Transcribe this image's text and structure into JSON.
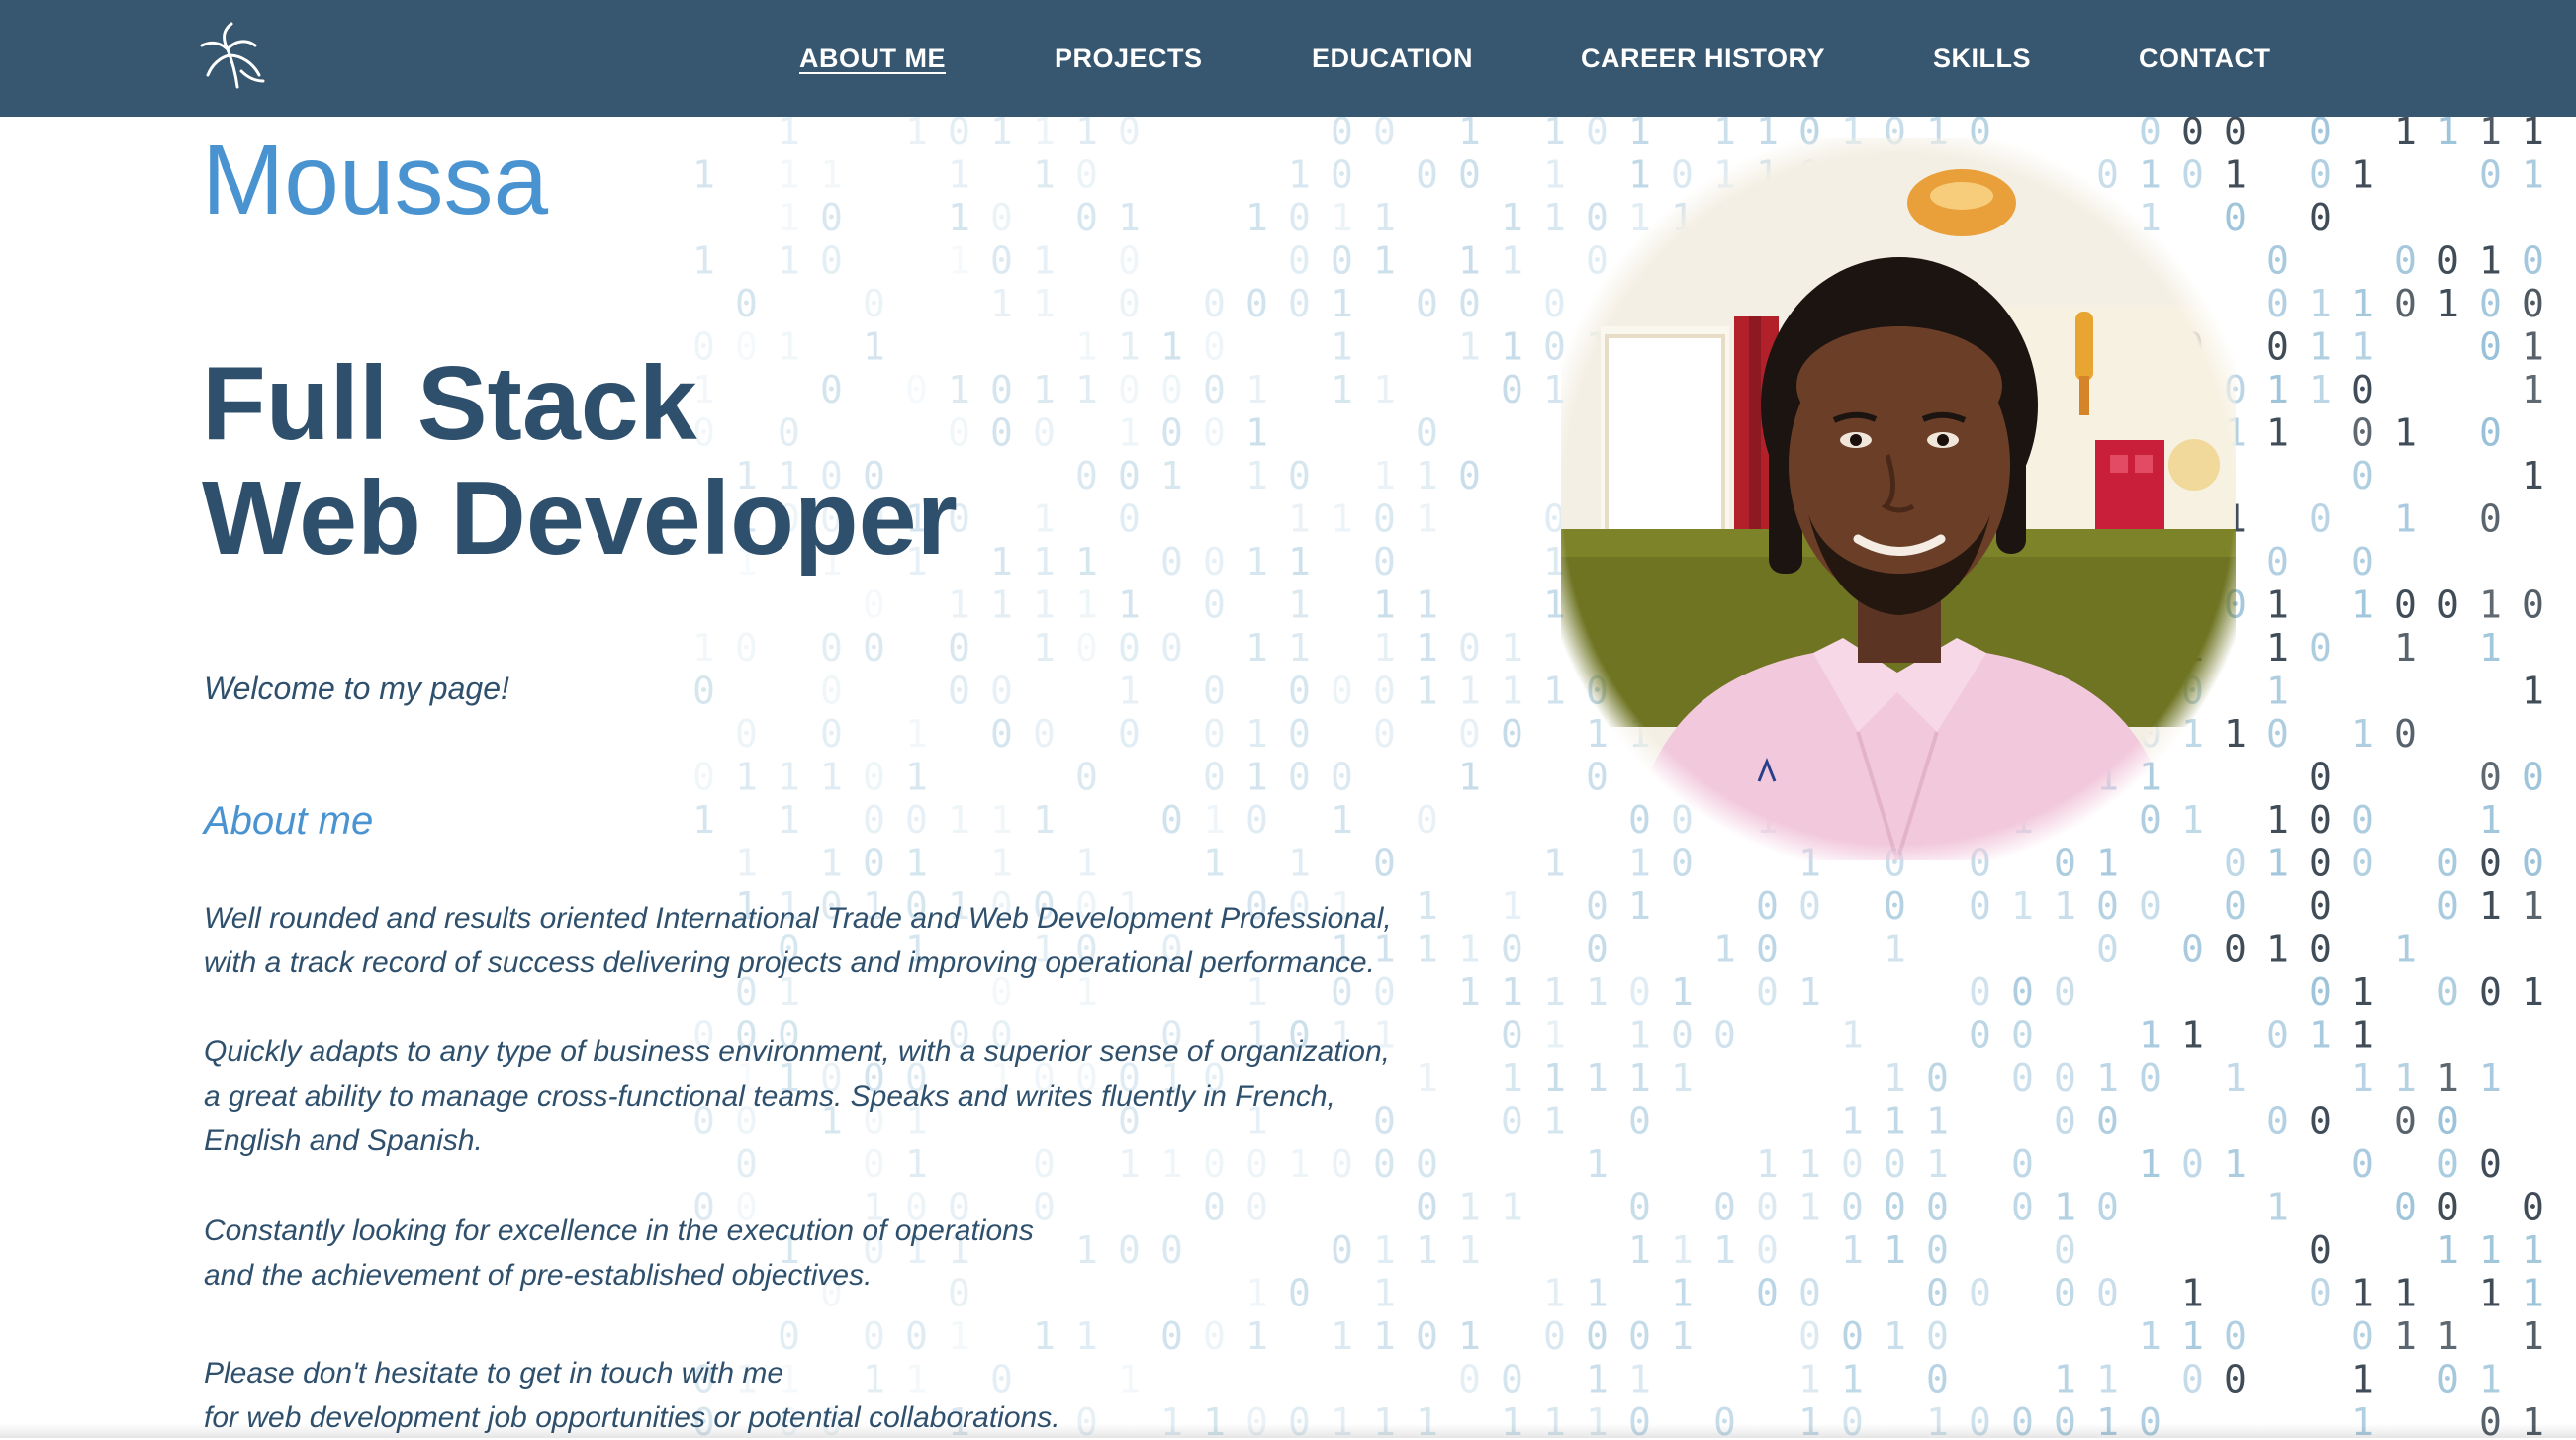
{
  "nav": {
    "logo_icon": "palm-leaf-logo-icon",
    "items": [
      {
        "label": "ABOUT ME",
        "active": true
      },
      {
        "label": "PROJECTS",
        "active": false
      },
      {
        "label": "EDUCATION",
        "active": false
      },
      {
        "label": "CAREER HISTORY",
        "active": false
      },
      {
        "label": "SKILLS",
        "active": false
      },
      {
        "label": "CONTACT",
        "active": false
      }
    ]
  },
  "hero": {
    "name": "Moussa",
    "title_line1": "Full Stack",
    "title_line2": "Web Developer",
    "welcome": "Welcome to my page!"
  },
  "about": {
    "heading": "About me",
    "p1_line1": "Well rounded and results oriented International Trade and Web Development Professional,",
    "p1_line2": "with a track record of success delivering projects and improving operational performance.",
    "p2_line1": "Quickly adapts to any type of business environment, with a superior sense of organization,",
    "p2_line2": "a great ability to manage cross-functional teams. Speaks and writes fluently in French,",
    "p2_line3": "English and Spanish.",
    "p3_line1": "Constantly looking for excellence in the execution of operations",
    "p3_line2": "and the achievement of pre-established objectives.",
    "p4_line1": "Please don't hesitate to get in touch with me",
    "p4_line2": "for web development job opportunities or potential collaborations."
  },
  "colors": {
    "navbar": "#37566f",
    "accent_blue": "#4a93d1",
    "heading_dark": "#2f506d",
    "binary_digits": "#6fa8c9"
  },
  "background": {
    "type": "binary-digit-rain",
    "icon": "binary-code-icon"
  },
  "profile": {
    "icon": "profile-photo-icon"
  }
}
